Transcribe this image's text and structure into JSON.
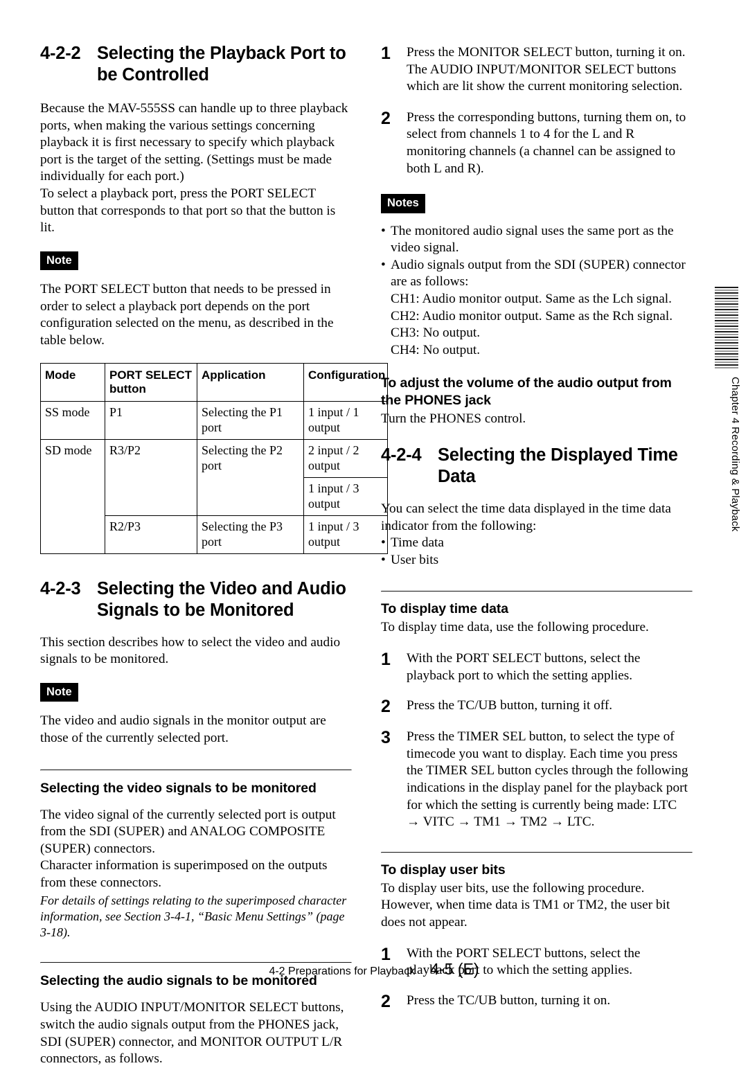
{
  "document": {
    "footer": {
      "section_ref": "4-2  Preparations for Playback",
      "page_number": "4-5 (E)"
    },
    "side_tab": {
      "label": "Chapter 4   Recording & Playback"
    }
  },
  "left_column": {
    "section_422": {
      "number": "4-2-2",
      "title": "Selecting the Playback Port to be Controlled",
      "paragraph_1": "Because the MAV-555SS can handle up to three playback ports, when making the various settings concerning playback it is first necessary to specify which playback port is the target of the setting.  (Settings must be made individually for each port.)",
      "paragraph_2": "To select a playback port, press the PORT SELECT button that corresponds to that port so that the button is lit.",
      "note_badge": "Note",
      "note_text": "The PORT SELECT button that needs to be pressed in order to select a playback port depends on the port configuration selected on the menu, as described in the table below.",
      "table": {
        "headers": [
          "Mode",
          "PORT SELECT button",
          "Application",
          "Configuration"
        ],
        "rows": [
          {
            "mode": "SS mode",
            "button": "P1",
            "application": "Selecting the P1 port",
            "configuration": "1 input / 1 output"
          },
          {
            "mode": "SD mode",
            "button": "R3/P2",
            "application": "Selecting the P2 port",
            "configuration": "2 input / 2 output"
          },
          {
            "mode": "",
            "button": "",
            "application": "",
            "configuration": "1 input / 3 output"
          },
          {
            "mode": "",
            "button": "R2/P3",
            "application": "Selecting the P3 port",
            "configuration": "1 input / 3 output"
          }
        ]
      }
    },
    "section_423": {
      "number": "4-2-3",
      "title": "Selecting the Video and Audio Signals to be Monitored",
      "intro": "This section describes how to select the video and audio signals to be monitored.",
      "note_badge": "Note",
      "note_text": "The video and audio signals in the monitor output are those of the currently selected port.",
      "sub_video": {
        "heading": "Selecting the video signals to be monitored",
        "paragraph_1": "The video signal of the currently selected port is output from the SDI (SUPER) and ANALOG COMPOSITE (SUPER) connectors.",
        "paragraph_2": "Character information is superimposed on the outputs from these connectors.",
        "italic_ref": "For details of settings relating to the superimposed character information, see Section 3-4-1, “Basic Menu Settings” (page 3-18)."
      },
      "sub_audio": {
        "heading": "Selecting the audio signals to be monitored",
        "paragraph_1": "Using the AUDIO INPUT/MONITOR SELECT buttons, switch the audio signals output from the PHONES jack, SDI (SUPER) connector, and MONITOR OUTPUT L/R connectors, as follows."
      }
    }
  },
  "right_column": {
    "steps_monitor": [
      {
        "number": "1",
        "text": "Press the MONITOR SELECT button, turning it on. The AUDIO INPUT/MONITOR SELECT buttons which are lit show the current monitoring selection."
      },
      {
        "number": "2",
        "text": "Press the corresponding buttons, turning them on, to select from channels 1 to 4 for the L and R monitoring channels (a channel can be assigned to both L and R)."
      }
    ],
    "notes_badge": "Notes",
    "notes": [
      {
        "text": "The monitored audio signal uses the same port as the video signal.",
        "sublines": []
      },
      {
        "text": "Audio signals output from the SDI (SUPER) connector are as follows:",
        "sublines": [
          "CH1: Audio monitor output. Same as the Lch signal.",
          "CH2: Audio monitor output. Same as the Rch signal.",
          "CH3: No output.",
          "CH4: No output."
        ]
      }
    ],
    "phones_heading": "To adjust the volume of the audio output from the PHONES jack",
    "phones_text": "Turn the PHONES control.",
    "section_424": {
      "number": "4-2-4",
      "title": "Selecting the Displayed Time Data",
      "intro": "You can select the time data displayed in the time data indicator  from the following:",
      "options": [
        "Time data",
        "User bits"
      ],
      "time_data": {
        "heading": "To display time data",
        "intro": "To display time data, use the following procedure.",
        "steps": [
          {
            "number": "1",
            "text": "With the PORT SELECT buttons, select the playback port to which the setting applies."
          },
          {
            "number": "2",
            "text": "Press the TC/UB button, turning it off."
          },
          {
            "number": "3",
            "text": "Press the TIMER SEL button, to select the type of timecode you want to display. Each time you press the TIMER SEL button cycles through the following indications in the display panel for the playback port for which the setting is currently being made: LTC → VITC → TM1 → TM2 → LTC."
          }
        ]
      },
      "user_bits": {
        "heading": "To display user bits",
        "intro": "To display user bits, use the following procedure. However, when time data is TM1 or TM2, the user bit does not appear.",
        "steps": [
          {
            "number": "1",
            "text": "With the PORT SELECT buttons, select the playback port to which the setting applies."
          },
          {
            "number": "2",
            "text": "Press the TC/UB button, turning it on."
          }
        ]
      }
    }
  }
}
